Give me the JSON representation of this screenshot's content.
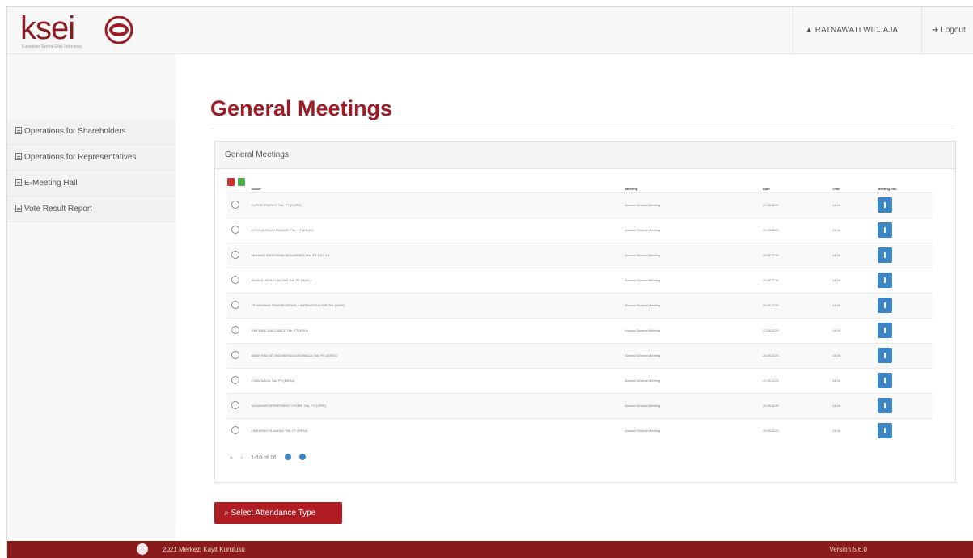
{
  "brand": {
    "logo_text": "ksei",
    "logo_sub": "Kustodian Sentral Efek Indonesia"
  },
  "header": {
    "user_name": "RATNAWATI WIDJAJA",
    "logout_label": "Logout"
  },
  "sidebar": {
    "items": [
      {
        "label": "Operations for Shareholders"
      },
      {
        "label": "Operations for Representatives"
      },
      {
        "label": "E-Meeting Hall"
      },
      {
        "label": "Vote Result Report"
      }
    ]
  },
  "main": {
    "page_title": "General Meetings",
    "panel_title": "General Meetings",
    "columns": [
      "Issuer",
      "Meeting",
      "Date",
      "Time",
      "Meeting Info"
    ],
    "rows": [
      {
        "issuer": "SUPER ENERGY Tbk, PT (SURE)",
        "meeting": "Annual General Meeting",
        "date": "22.06.2021",
        "time": "14:00"
      },
      {
        "issuer": "KOTA BANGUN MANDIRI Tbk, PT (KBAG)",
        "meeting": "Annual General Meeting",
        "date": "25.06.2021",
        "time": "14:00"
      },
      {
        "issuer": "MAHAKA INVESTAMA NUSANTARA Tbk, PT (OCCC)",
        "meeting": "Annual General Meeting",
        "date": "25.06.2021",
        "time": "14:00"
      },
      {
        "issuer": "BUANA LINTAS LAUTAN Tbk, PT (BULL)",
        "meeting": "Annual General Meeting",
        "date": "22.06.2021",
        "time": "14:00"
      },
      {
        "issuer": "PT WAHANA TRANSPORTASI & INFRASTRUKTUR Tbk (WINT)",
        "meeting": "Annual General Meeting",
        "date": "25.06.2021",
        "time": "14:00"
      },
      {
        "issuer": "KMI WIRE AND CABLE Tbk, PT (KBLI)",
        "meeting": "Annual General Meeting",
        "date": "22.06.2021",
        "time": "14:00"
      },
      {
        "issuer": "BANK RAKYAT INDONESIA AGRONIAGA Tbk, PT (AGRO)",
        "meeting": "Annual General Meeting",
        "date": "25.06.2021",
        "time": "14:00"
      },
      {
        "issuer": "CIMB NIAGA Tbk, PT (BNGA)",
        "meeting": "Annual General Meeting",
        "date": "22.06.2021",
        "time": "14:00"
      },
      {
        "issuer": "MATAHARI DEPARTMENT STORE Tbk, PT (LPPF)",
        "meeting": "Annual General Meeting",
        "date": "25.06.2021",
        "time": "14:00"
      },
      {
        "issuer": "HARAPAN CILANDAK Tbk, PT (HRTA)",
        "meeting": "Annual General Meeting",
        "date": "25.06.2021",
        "time": "14:00"
      }
    ],
    "pagination": {
      "first": "«",
      "prev": "‹",
      "info": "1-10 of 16"
    },
    "attendance_button": "Select Attendance Type"
  },
  "footer": {
    "copyright": "2021 Merkezi Kayit Kurulusu",
    "version": "Version 5.6.0"
  }
}
